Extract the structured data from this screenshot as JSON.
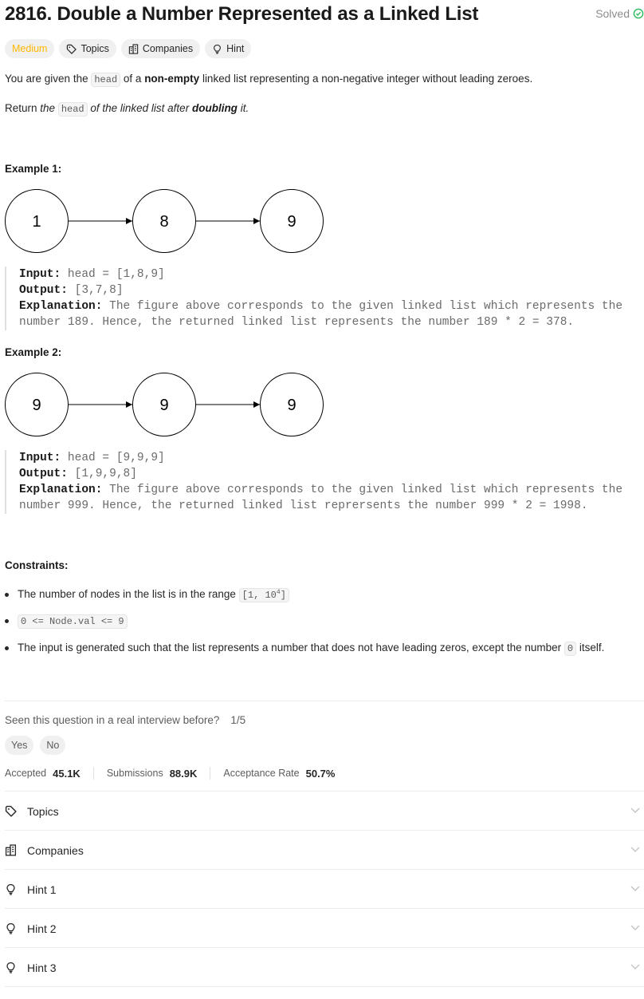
{
  "problem": {
    "title": "2816. Double a Number Represented as a Linked List",
    "status": "Solved",
    "difficulty": "Medium",
    "tags": [
      "Topics",
      "Companies",
      "Hint"
    ]
  },
  "description": {
    "p1": [
      "You are given the ",
      "head",
      " of a ",
      "non-empty",
      " linked list representing a non-negative integer without leading zeroes."
    ],
    "p2": [
      "Return ",
      "the ",
      "head",
      " of the linked list after ",
      "doubling",
      " it."
    ]
  },
  "examples": [
    {
      "heading": "Example 1:",
      "nodes": [
        "1",
        "8",
        "9"
      ],
      "input_label": "Input:",
      "input": " head = [1,8,9]",
      "output_label": "Output:",
      "output": " [3,7,8]",
      "explanation_label": "Explanation:",
      "explanation_1": " The figure above corresponds to the given linked list which represents the",
      "explanation_2": "number 189. Hence, the returned linked list represents the number 189 * 2 = 378."
    },
    {
      "heading": "Example 2:",
      "nodes": [
        "9",
        "9",
        "9"
      ],
      "input_label": "Input:",
      "input": " head = [9,9,9]",
      "output_label": "Output:",
      "output": " [1,9,9,8]",
      "explanation_label": "Explanation:",
      "explanation_1": " The figure above corresponds to the given linked list which represents the",
      "explanation_2": "number 999. Hence, the returned linked list reprersents the number 999 * 2 = 1998."
    }
  ],
  "constraints": {
    "heading": "Constraints:",
    "c1_text": "The number of nodes in the list is in the range ",
    "c1_code": "[1, 10",
    "c1_sup": "4",
    "c1_close": "]",
    "c2_code": "0 <= Node.val <= 9",
    "c3_text": "The input is generated such that the list represents a number that does not have leading zeros, except the number ",
    "c3_code": "0",
    "c3_end": " itself."
  },
  "interview": {
    "question": "Seen this question in a real interview before?",
    "count": "1/5",
    "yes": "Yes",
    "no": "No"
  },
  "stats": {
    "accepted_label": "Accepted",
    "accepted": "45.1K",
    "submissions_label": "Submissions",
    "submissions": "88.9K",
    "rate_label": "Acceptance Rate",
    "rate": "50.7%"
  },
  "sections": [
    {
      "label": "Topics",
      "icon": "tag-icon"
    },
    {
      "label": "Companies",
      "icon": "building-icon"
    },
    {
      "label": "Hint 1",
      "icon": "lightbulb-icon"
    },
    {
      "label": "Hint 2",
      "icon": "lightbulb-icon"
    },
    {
      "label": "Hint 3",
      "icon": "lightbulb-icon"
    }
  ],
  "colors": {
    "medium": "#ffb800",
    "solved_check": "#2cbb5d"
  }
}
